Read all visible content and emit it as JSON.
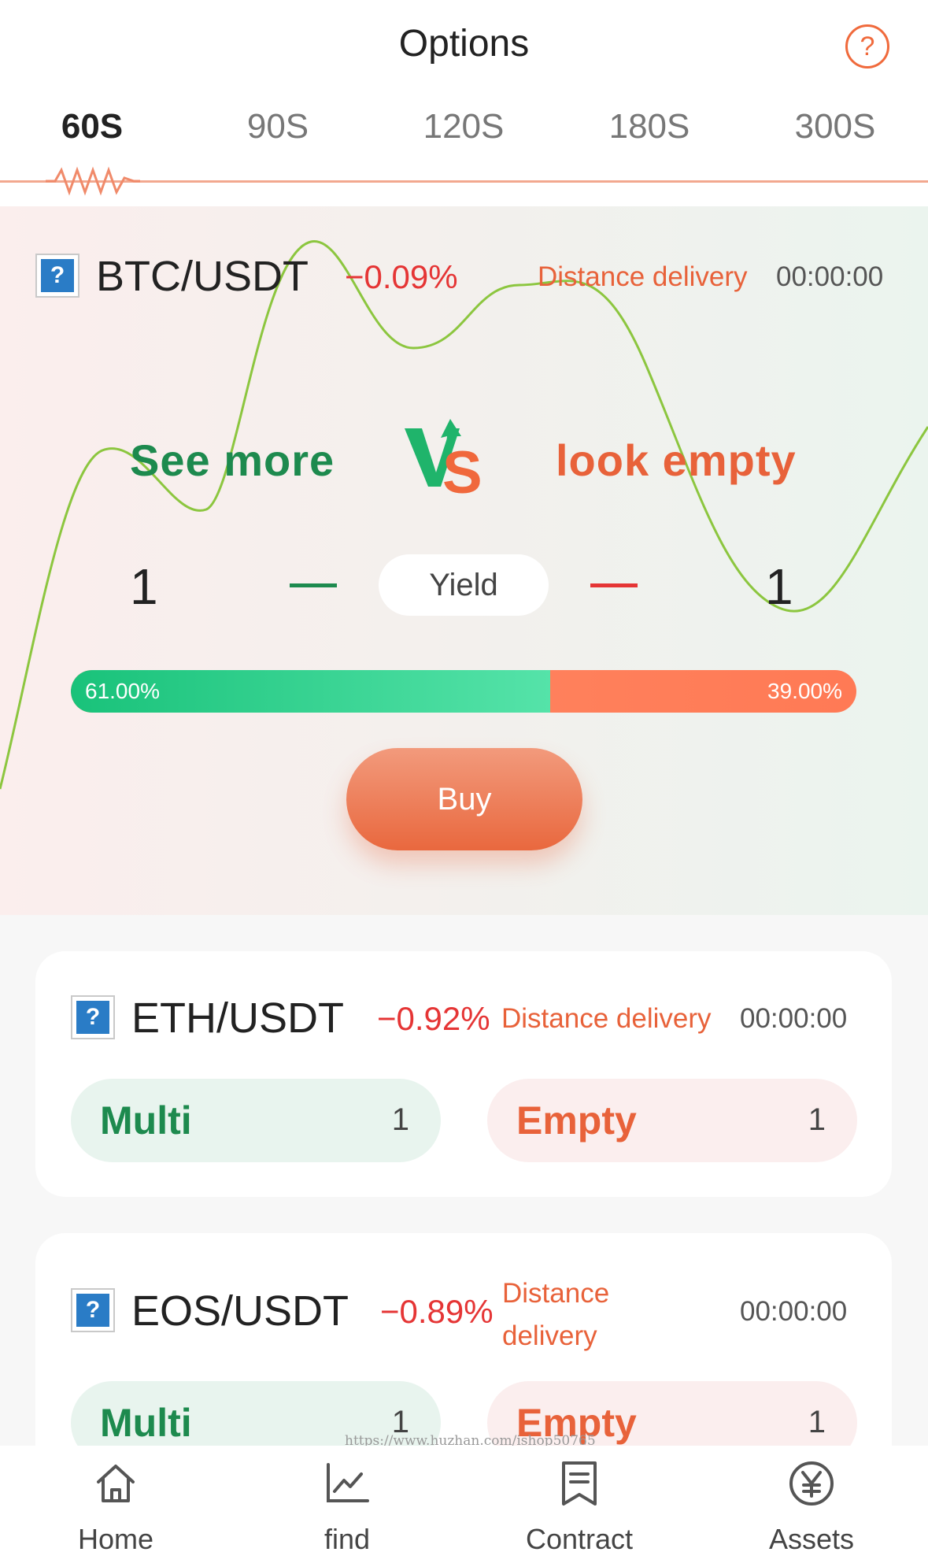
{
  "header": {
    "title": "Options",
    "help_icon": "question-circle-icon",
    "tabs": [
      "60S",
      "90S",
      "120S",
      "180S",
      "300S"
    ],
    "active_tab": "60S"
  },
  "hero": {
    "pair": "BTC/USDT",
    "change": "−0.09%",
    "distance_label": "Distance delivery",
    "countdown": "00:00:00",
    "long_label": "See more",
    "short_label": "look empty",
    "long_value": "1",
    "short_value": "1",
    "yield_label": "Yield",
    "long_ratio": 0.61,
    "long_ratio_text": "61.00%",
    "short_ratio_text": "39.00%",
    "buy_label": "Buy"
  },
  "cards": [
    {
      "pair": "ETH/USDT",
      "change": "−0.92%",
      "distance_label": "Distance delivery",
      "countdown": "00:00:00",
      "long_label": "Multi",
      "long_value": "1",
      "short_label": "Empty",
      "short_value": "1"
    },
    {
      "pair": "EOS/USDT",
      "change": "−0.89%",
      "distance_label": "Distance delivery",
      "countdown": "00:00:00",
      "long_label": "Multi",
      "long_value": "1",
      "short_label": "Empty",
      "short_value": "1"
    }
  ],
  "watermark": "https://www.huzhan.com/ishop50765",
  "nav": [
    {
      "label": "Home",
      "icon": "home-icon"
    },
    {
      "label": "find",
      "icon": "chart-line-icon"
    },
    {
      "label": "Contract",
      "icon": "document-icon"
    },
    {
      "label": "Assets",
      "icon": "yen-circle-icon"
    }
  ],
  "colors": {
    "accent_orange": "#e8623a",
    "long_green": "#1d8a4e",
    "negative_red": "#e53535",
    "coin_icon_blue": "#2a7cc6"
  }
}
